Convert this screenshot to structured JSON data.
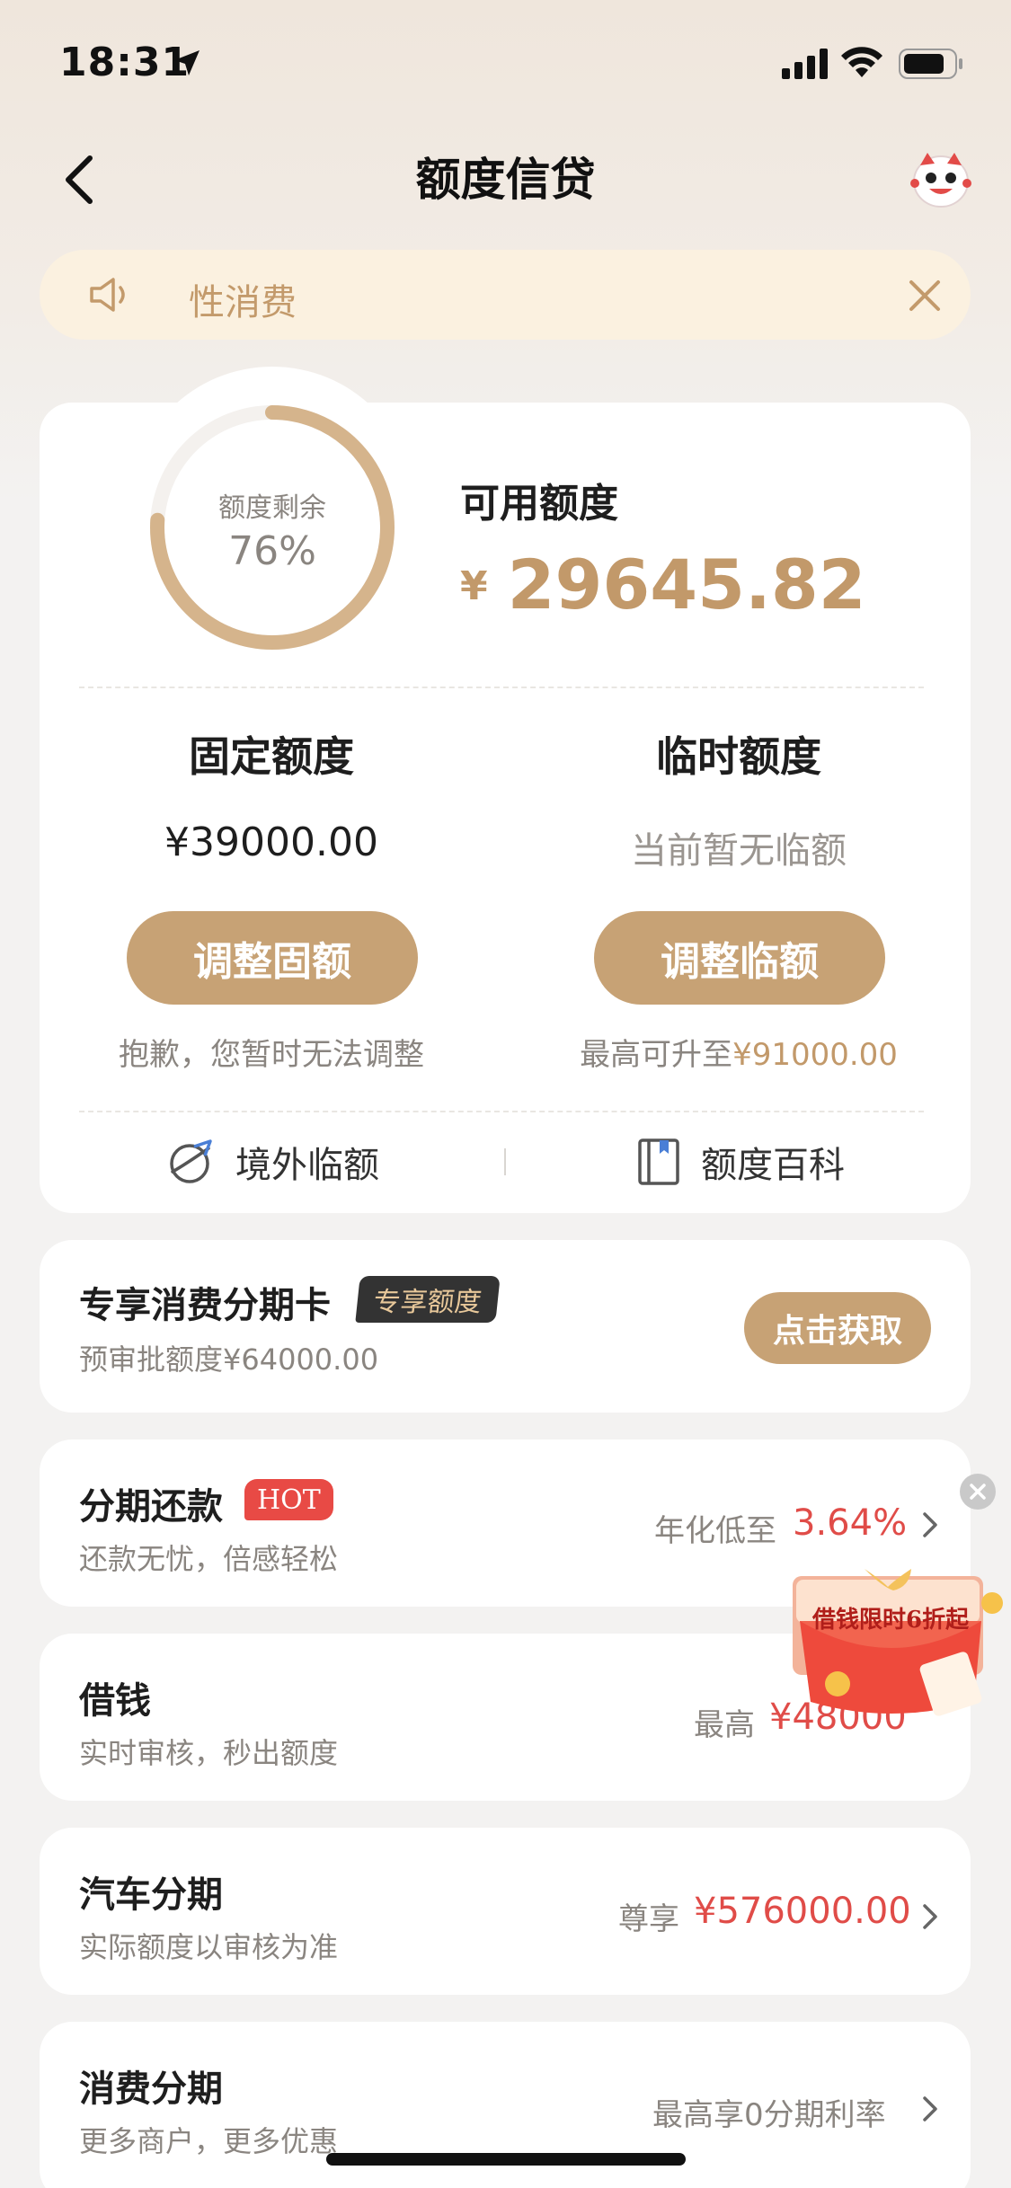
{
  "status_bar": {
    "time": "18:31"
  },
  "nav": {
    "title": "额度信贷"
  },
  "notice": {
    "text": "性消费"
  },
  "credit": {
    "ring_label": "额度剩余",
    "ring_percent": "76%",
    "ring_fraction": 0.76,
    "available_label": "可用额度",
    "currency": "¥",
    "available_value": "29645.82",
    "fixed": {
      "title": "固定额度",
      "value": "¥39000.00",
      "button": "调整固额",
      "note": "抱歉，您暂时无法调整"
    },
    "temp": {
      "title": "临时额度",
      "value": "当前暂无临额",
      "button": "调整临额",
      "note_prefix": "最高可升至",
      "note_value": "¥91000.00"
    },
    "links": {
      "overseas": "境外临额",
      "wiki": "额度百科"
    }
  },
  "exclusive_card": {
    "title": "专享消费分期卡",
    "tag": "专享额度",
    "subtitle": "预审批额度¥64000.00",
    "button": "点击获取"
  },
  "products": [
    {
      "title": "分期还款",
      "badge": "HOT",
      "subtitle": "还款无忧，倍感轻松",
      "right_label": "年化低至",
      "right_value": "3.64%"
    },
    {
      "title": "借钱",
      "subtitle": "实时审核，秒出额度",
      "right_label": "最高",
      "right_value": "¥48000"
    },
    {
      "title": "汽车分期",
      "subtitle": "实际额度以审核为准",
      "right_label": "尊享",
      "right_value": "¥576000.00"
    },
    {
      "title": "消费分期",
      "subtitle": "更多商户，更多优惠",
      "right_label": "最高享0分期利率",
      "right_value": ""
    }
  ],
  "promo": {
    "text": "借钱限时6折起"
  },
  "colors": {
    "gold": "#c7a275",
    "red": "#e04c48",
    "background": "#f3f2f1"
  }
}
